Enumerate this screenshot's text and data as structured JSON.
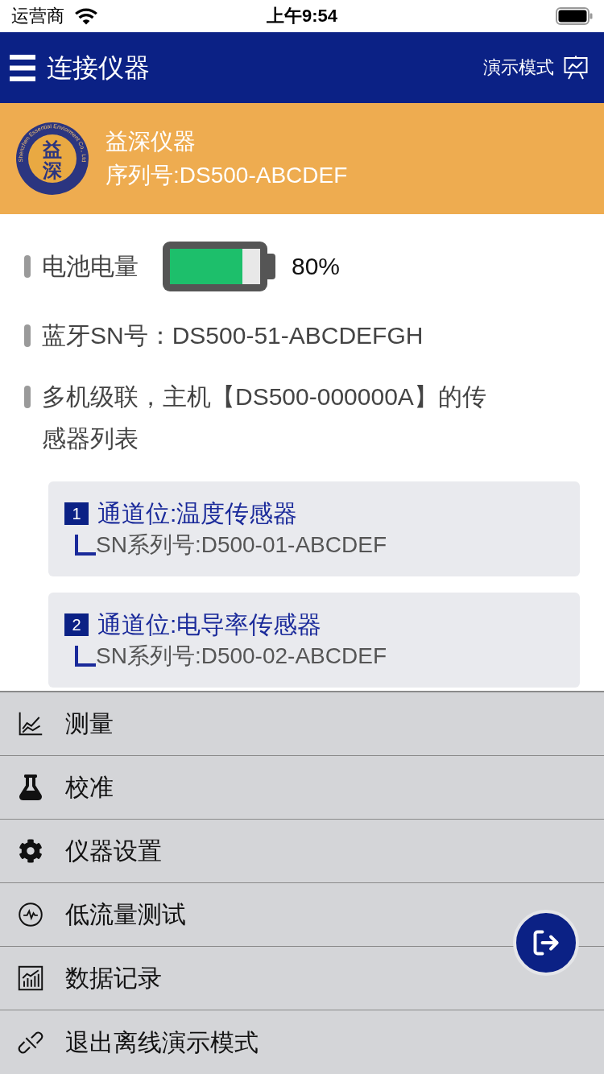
{
  "status_bar": {
    "carrier": "运营商",
    "time": "上午9:54"
  },
  "nav_bar": {
    "title": "连接仪器",
    "action": "演示模式"
  },
  "device": {
    "logo": {
      "mark": "益深",
      "ring_text": "Shenzhen Essential Enviorment Co., Ltd"
    },
    "name": "益深仪器",
    "serial": "序列号:DS500-ABCDEF"
  },
  "info_rows": [
    {
      "kind": "battery",
      "label": "电池电量",
      "level": 0.8,
      "reading": "80%"
    },
    {
      "kind": "text",
      "label": "蓝牙SN号：DS500-51-ABCDEFGH"
    },
    {
      "kind": "text",
      "label": "多机级联，主机【DS500-000000A】的传感器列表"
    }
  ],
  "sensors": [
    {
      "index": "1",
      "channel": "通道位:温度传感器",
      "serial": "SN系列号:D500-01-ABCDEF"
    },
    {
      "index": "2",
      "channel": "通道位:电导率传感器",
      "serial": "SN系列号:D500-02-ABCDEF"
    }
  ],
  "menu": [
    {
      "label": "测量"
    },
    {
      "label": "校准"
    },
    {
      "label": "仪器设置"
    },
    {
      "label": "低流量测试"
    },
    {
      "label": "数据记录"
    },
    {
      "label": "退出离线演示模式"
    }
  ]
}
